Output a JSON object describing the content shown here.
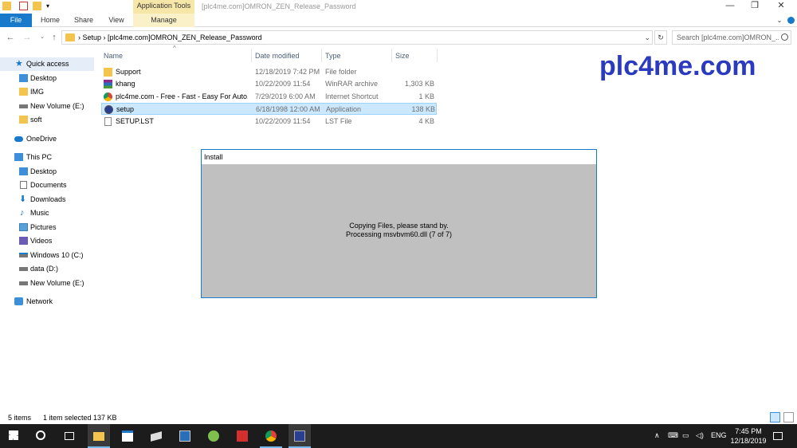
{
  "window": {
    "title": "[plc4me.com]OMRON_ZEN_Release_Password",
    "context_tab": "Application Tools",
    "minimize": "—",
    "maximize": "❐",
    "close": "✕"
  },
  "ribbon": {
    "tabs": [
      "File",
      "Home",
      "Share",
      "View",
      "Manage"
    ]
  },
  "address": {
    "path": "›  Setup  ›  [plc4me.com]OMRON_ZEN_Release_Password",
    "search_placeholder": "Search [plc4me.com]OMRON_..."
  },
  "nav": {
    "items": [
      {
        "label": "Quick access",
        "icon": "star-icon"
      },
      {
        "label": "Desktop",
        "icon": "desktop-icon"
      },
      {
        "label": "IMG",
        "icon": "folder-icon"
      },
      {
        "label": "New Volume (E:)",
        "icon": "drive-icon"
      },
      {
        "label": "soft",
        "icon": "folder-icon"
      },
      {
        "label": "OneDrive",
        "icon": "cloud-icon"
      },
      {
        "label": "This PC",
        "icon": "pc-icon"
      },
      {
        "label": "Desktop",
        "icon": "desktop-icon"
      },
      {
        "label": "Documents",
        "icon": "documents-icon"
      },
      {
        "label": "Downloads",
        "icon": "downloads-icon"
      },
      {
        "label": "Music",
        "icon": "music-icon"
      },
      {
        "label": "Pictures",
        "icon": "pictures-icon"
      },
      {
        "label": "Videos",
        "icon": "videos-icon"
      },
      {
        "label": "Windows 10 (C:)",
        "icon": "windows-drive-icon"
      },
      {
        "label": "data (D:)",
        "icon": "drive-icon"
      },
      {
        "label": "New Volume (E:)",
        "icon": "drive-icon"
      },
      {
        "label": "Network",
        "icon": "network-icon"
      }
    ]
  },
  "filelist": {
    "columns": [
      "Name",
      "Date modified",
      "Type",
      "Size"
    ],
    "rows": [
      {
        "name": "Support",
        "date": "12/18/2019 7:42 PM",
        "type": "File folder",
        "size": "",
        "icon": "folder-icon"
      },
      {
        "name": "khang",
        "date": "10/22/2009 11:54",
        "type": "WinRAR archive",
        "size": "1,303 KB",
        "icon": "winrar-icon"
      },
      {
        "name": "plc4me.com - Free - Fast - Easy For Auto...",
        "date": "7/29/2019 6:00 AM",
        "type": "Internet Shortcut",
        "size": "1 KB",
        "icon": "chrome-icon"
      },
      {
        "name": "setup",
        "date": "6/18/1998 12:00 AM",
        "type": "Application",
        "size": "138 KB",
        "icon": "setup-app-icon"
      },
      {
        "name": "SETUP.LST",
        "date": "10/22/2009 11:54",
        "type": "LST File",
        "size": "4 KB",
        "icon": "file-icon"
      }
    ],
    "selected_index": 3
  },
  "watermark": "plc4me.com",
  "install_dialog": {
    "title": "Install",
    "line1": "Copying Files, please stand by.",
    "line2": "Processing msvbvm60.dll (7 of 7)"
  },
  "status": {
    "items_count": "5 items",
    "selection": "1 item selected  137 KB"
  },
  "taskbar": {
    "language": "ENG",
    "time": "7:45 PM",
    "date": "12/18/2019"
  },
  "colors": {
    "accent": "#1979ca",
    "selection": "#cce8ff",
    "dialog_gray": "#c0c0c0",
    "watermark": "#2b3bbf",
    "taskbar": "#1c1c1c"
  }
}
